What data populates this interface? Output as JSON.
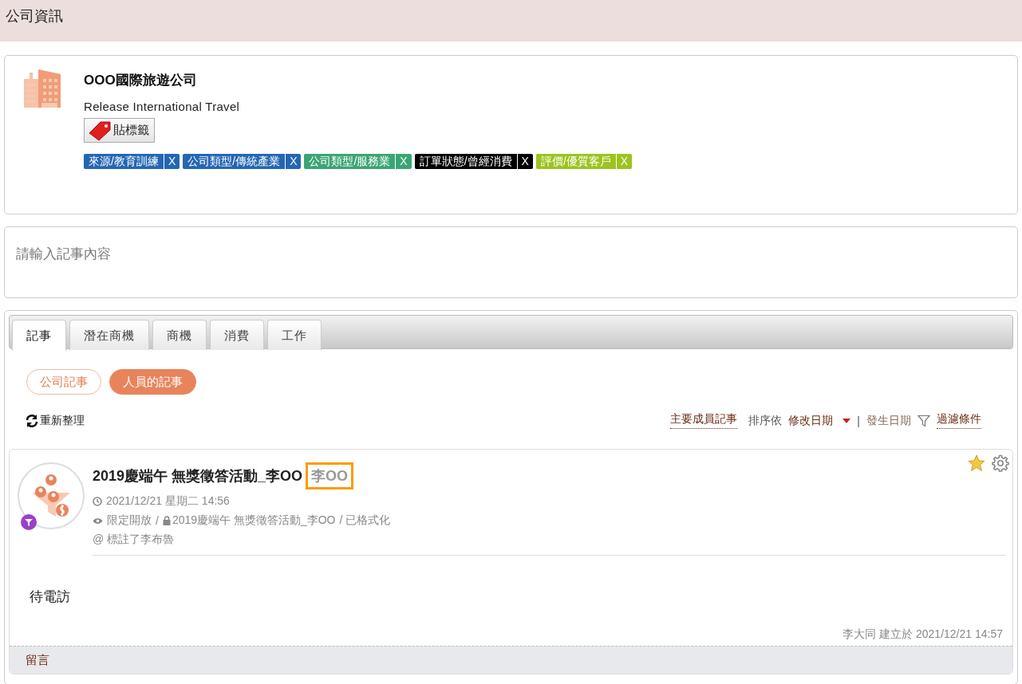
{
  "header": {
    "title": "公司資訊"
  },
  "company": {
    "name": "OOO國際旅遊公司",
    "english_name": "Release International Travel",
    "tag_button": "貼標籤",
    "tags": [
      {
        "label": "來源/教育訓練",
        "remove": "X",
        "color": "#2466b5"
      },
      {
        "label": "公司類型/傳統產業",
        "remove": "X",
        "color": "#2466b5"
      },
      {
        "label": "公司類型/服務業",
        "remove": "X",
        "color": "#3aa574"
      },
      {
        "label": "訂單狀態/曾經消費",
        "remove": "X",
        "color": "#000000"
      },
      {
        "label": "評價/優質客戶",
        "remove": "X",
        "color": "#9cc31e"
      }
    ]
  },
  "note_input": {
    "placeholder": "請輸入記事內容"
  },
  "tabs": [
    {
      "label": "記事",
      "selected": true
    },
    {
      "label": "潛在商機",
      "selected": false
    },
    {
      "label": "商機",
      "selected": false
    },
    {
      "label": "消費",
      "selected": false
    },
    {
      "label": "工作",
      "selected": false
    }
  ],
  "filters": [
    {
      "label": "公司記事",
      "selected": false
    },
    {
      "label": "人員的記事",
      "selected": true
    }
  ],
  "toolbar": {
    "refresh": "重新整理",
    "members": "主要成員記事",
    "sort_label": "排序依",
    "separator": "|",
    "sort_options": [
      {
        "label": "修改日期",
        "selected": true
      },
      {
        "label": "發生日期",
        "selected": false
      }
    ],
    "filter": "過濾條件"
  },
  "note": {
    "title": "2019慶端午 無獎徵答活動_李OO",
    "title_extra": "李OO",
    "title_extra_highlighted": true,
    "starred": true,
    "datetime": "2021/12/21 星期二 14:56",
    "visibility": "限定開放",
    "path": "/",
    "campaign": "2019慶端午 無獎徵答活動_李OO",
    "format": "/ 已格式化",
    "mention": "@ 標註了李布魯",
    "body": "待電訪",
    "footer": "李大同 建立於 2021/12/21 14:57",
    "comment": "留言"
  }
}
